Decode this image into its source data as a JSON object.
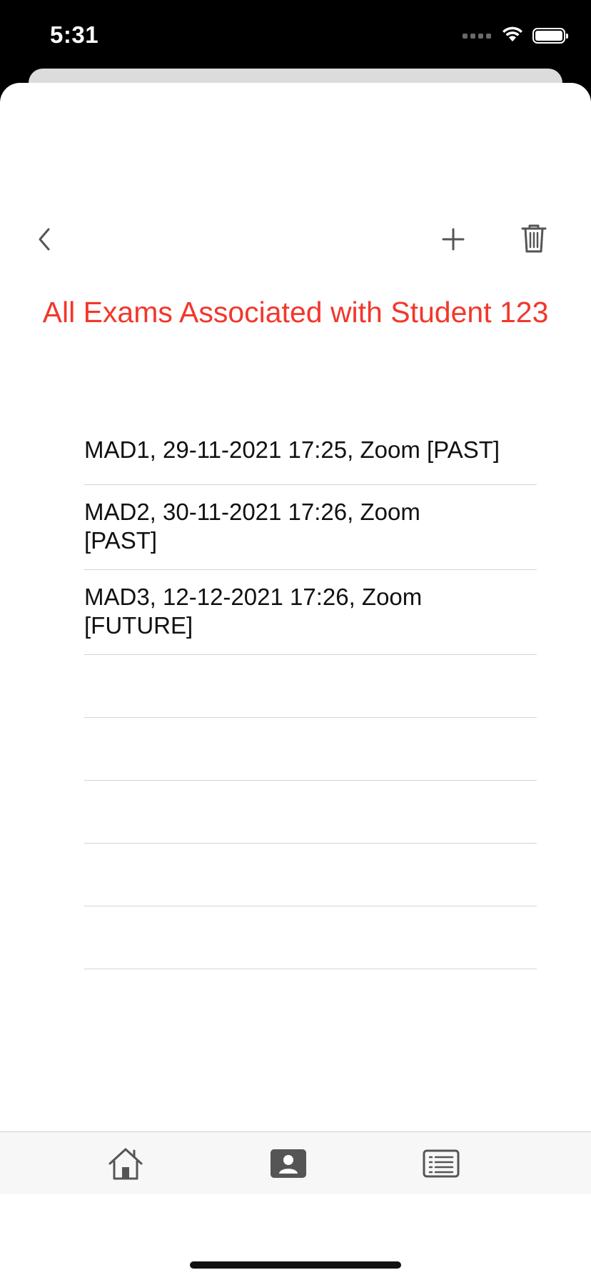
{
  "status_bar": {
    "time": "5:31",
    "icons": [
      "cellular-signal-icon",
      "wifi-icon",
      "battery-icon"
    ]
  },
  "nav": {
    "back_icon": "chevron-left-icon",
    "add_icon": "plus-icon",
    "delete_icon": "trash-icon"
  },
  "page": {
    "title": "All Exams Associated with Student 123"
  },
  "exams": [
    {
      "text": "MAD1, 29-11-2021 17:25, Zoom [PAST]"
    },
    {
      "text": "MAD2, 30-11-2021 17:26, Zoom [PAST]"
    },
    {
      "text": "MAD3, 12-12-2021 17:26, Zoom [FUTURE]"
    }
  ],
  "tab_bar": {
    "tabs": [
      {
        "icon": "house-icon"
      },
      {
        "icon": "person-card-icon"
      },
      {
        "icon": "list-icon"
      }
    ]
  },
  "colors": {
    "title_red": "#f2372b",
    "separator": "#d4d4d4",
    "tab_bar_bg": "#f7f7f7",
    "icon_gray": "#555555"
  }
}
